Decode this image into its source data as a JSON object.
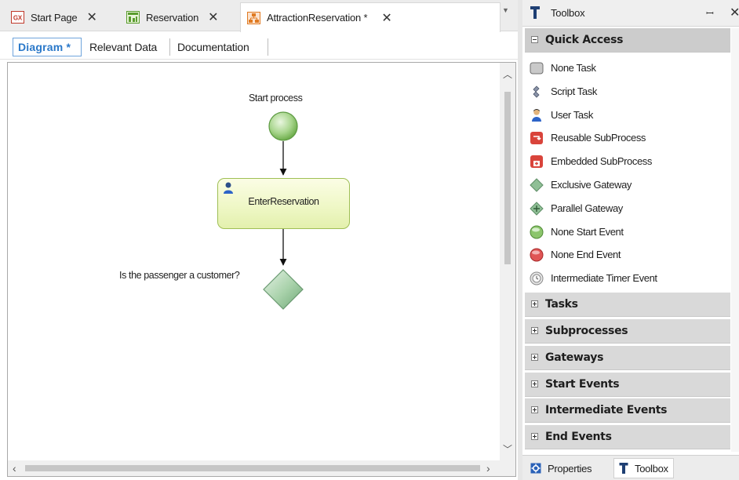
{
  "document_tabs": [
    {
      "label": "Start Page",
      "icon": "gx-logo-icon",
      "active": false
    },
    {
      "label": "Reservation",
      "icon": "transaction-icon",
      "active": false
    },
    {
      "label": "AttractionReservation *",
      "icon": "business-process-icon",
      "active": true
    }
  ],
  "view_tabs": [
    {
      "label": "Diagram *",
      "active": true
    },
    {
      "label": "Relevant Data",
      "active": false
    },
    {
      "label": "Documentation",
      "active": false
    }
  ],
  "diagram": {
    "start_event_label": "Start process",
    "task_label": "EnterReservation",
    "gateway_label": "Is the passenger a customer?"
  },
  "toolbox": {
    "title": "Toolbox",
    "quick_access": {
      "label": "Quick Access",
      "expanded": true,
      "items": [
        {
          "label": "None Task",
          "icon": "none-task-icon"
        },
        {
          "label": "Script Task",
          "icon": "script-task-icon"
        },
        {
          "label": "User Task",
          "icon": "user-task-icon"
        },
        {
          "label": "Reusable SubProcess",
          "icon": "reusable-subprocess-icon"
        },
        {
          "label": "Embedded SubProcess",
          "icon": "embedded-subprocess-icon"
        },
        {
          "label": "Exclusive Gateway",
          "icon": "exclusive-gateway-icon"
        },
        {
          "label": "Parallel Gateway",
          "icon": "parallel-gateway-icon"
        },
        {
          "label": "None Start Event",
          "icon": "start-event-icon"
        },
        {
          "label": "None End Event",
          "icon": "end-event-icon"
        },
        {
          "label": "Intermediate Timer Event",
          "icon": "timer-event-icon"
        }
      ]
    },
    "collapsed_sections": [
      {
        "label": "Tasks"
      },
      {
        "label": "Subprocesses"
      },
      {
        "label": "Gateways"
      },
      {
        "label": "Start Events"
      },
      {
        "label": "Intermediate Events"
      },
      {
        "label": "End Events"
      }
    ]
  },
  "bottom_tabs": [
    {
      "label": "Properties",
      "icon": "properties-icon",
      "active": false
    },
    {
      "label": "Toolbox",
      "icon": "toolbox-icon",
      "active": true
    }
  ],
  "colors": {
    "active_view_tab": "#2a78c9",
    "start_event": "#8cc56c",
    "end_event": "#e05555",
    "task_border": "#9fbf55",
    "gateway": "#8fbf96"
  }
}
